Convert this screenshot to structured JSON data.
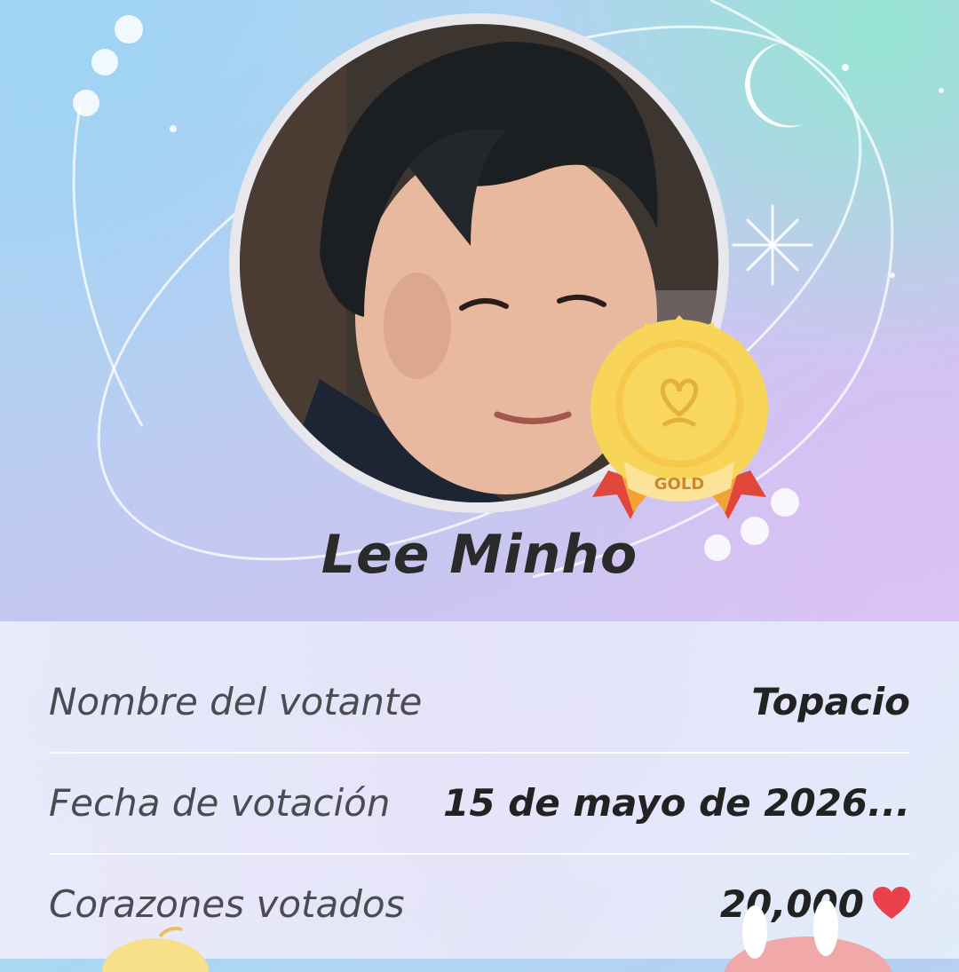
{
  "profile": {
    "name": "Lee Minho",
    "badge_text": "GOLD"
  },
  "details": {
    "voter_label": "Nombre del votante",
    "voter_value": "Topacio",
    "date_label": "Fecha de votación",
    "date_value": "15 de mayo de 2026...",
    "hearts_label": "Corazones votados",
    "hearts_value": "20,000"
  },
  "icons": [
    "moon-icon",
    "sparkle-icon",
    "gold-medal-icon",
    "heart-icon"
  ],
  "colors": {
    "heart": "#e8414a",
    "medal_gold": "#f6c94a",
    "ribbon_red": "#e0463a",
    "text_dark": "#222222"
  }
}
